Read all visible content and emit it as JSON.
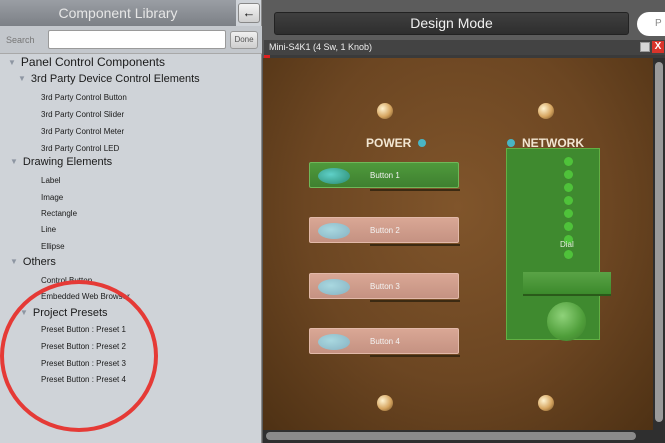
{
  "library": {
    "title": "Component Library",
    "back_icon": "←",
    "search_label": "Search",
    "search_value": "",
    "search_placeholder": "",
    "done_label": "Done"
  },
  "tree": {
    "panel_control": "Panel Control Components",
    "third_party": "3rd Party Device Control Elements",
    "third_party_items": [
      "3rd Party Control Button",
      "3rd Party Control Slider",
      "3rd Party Control Meter",
      "3rd Party Control LED"
    ],
    "drawing": "Drawing Elements",
    "drawing_items": [
      "Label",
      "Image",
      "Rectangle",
      "Line",
      "Ellipse"
    ],
    "others": "Others",
    "others_items": [
      "Control Button",
      "Embedded Web Browser"
    ],
    "project_presets": "Project Presets",
    "preset_items": [
      "Preset Button : Preset 1",
      "Preset Button : Preset 2",
      "Preset Button : Preset 3",
      "Preset Button : Preset 4"
    ]
  },
  "design": {
    "mode_label": "Design Mode",
    "pill_label": "P",
    "window_title": "Mini-S4K1 (4 Sw, 1 Knob)",
    "close_glyph": "X"
  },
  "panel": {
    "power_label": "POWER",
    "network_label": "NETWORK",
    "buttons": [
      "Button 1",
      "Button 2",
      "Button 3",
      "Button 4"
    ],
    "active_button": 1,
    "dial_label": "Dial",
    "meter_leds_lit": 8
  },
  "colors": {
    "accent_highlight": "#e53a36",
    "status_dot": "#49b5c4",
    "button_on": "#4f9a3c",
    "button_off": "#d9a795"
  }
}
